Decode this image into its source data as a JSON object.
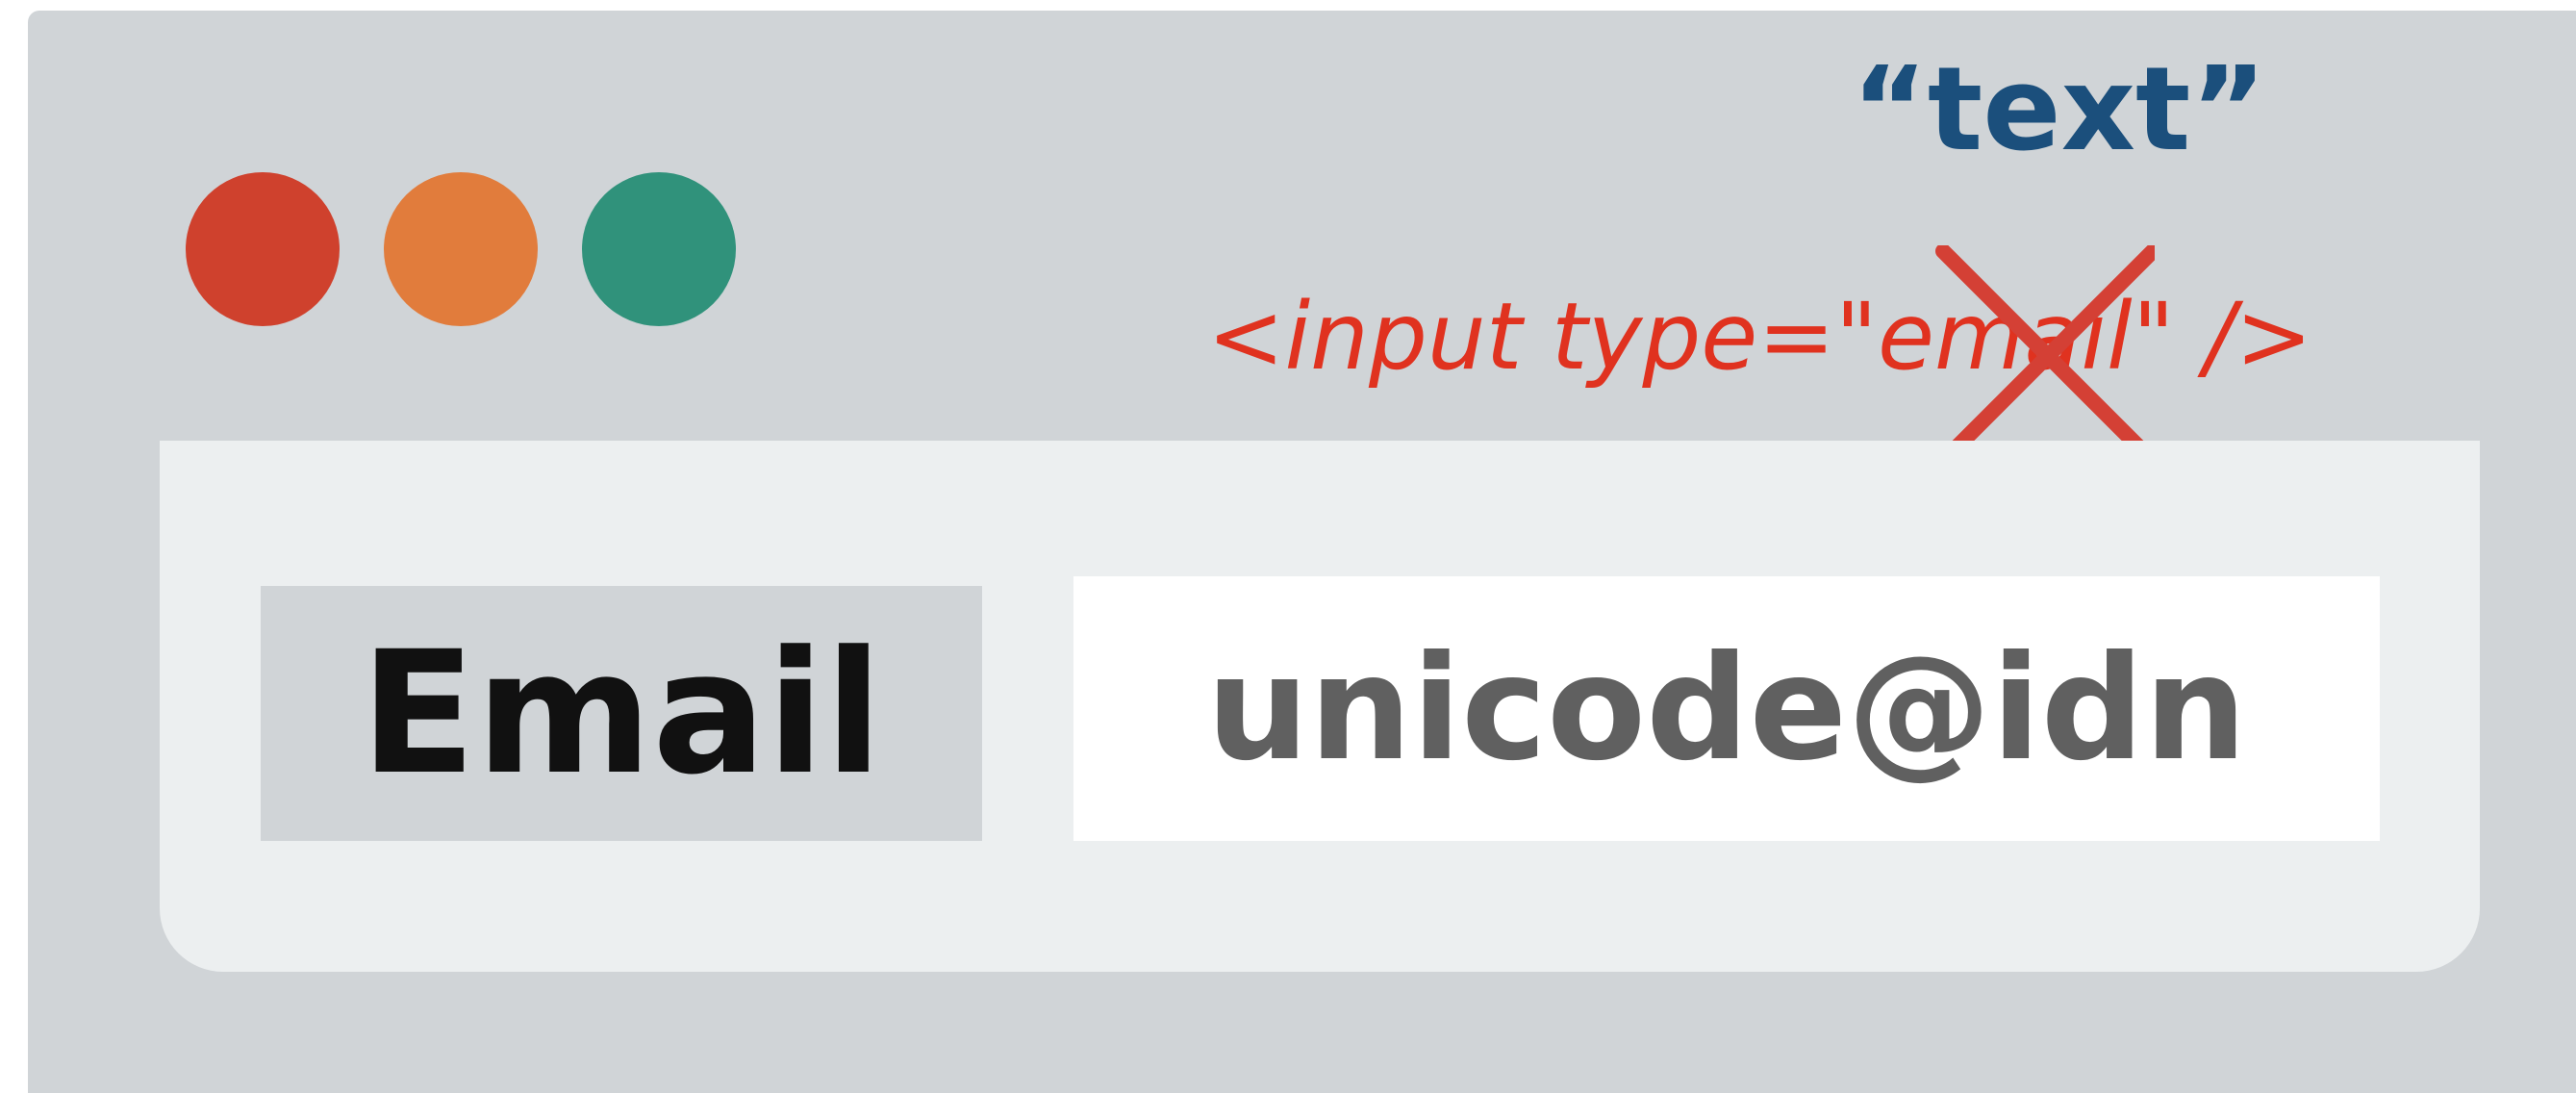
{
  "colors": {
    "window_bg": "#d0d4d7",
    "panel_bg": "#eceff0",
    "red": "#cf412d",
    "orange": "#e17c3c",
    "green": "#30927b",
    "text_blue": "#1b4f7c",
    "error_red": "#e0321f",
    "strike_red": "#d44035",
    "value_gray": "#606060"
  },
  "window": {
    "traffic_lights": [
      {
        "name": "close",
        "color": "#cf412d"
      },
      {
        "name": "minimize",
        "color": "#e17c3c"
      },
      {
        "name": "maximize",
        "color": "#30927b"
      }
    ]
  },
  "annotation": {
    "suggested_type": "“text”",
    "rejected_code": "<input type=\"email\" />",
    "strike_icon": "cross-out-icon"
  },
  "form": {
    "label": "Email",
    "value": "unicode@idn"
  }
}
